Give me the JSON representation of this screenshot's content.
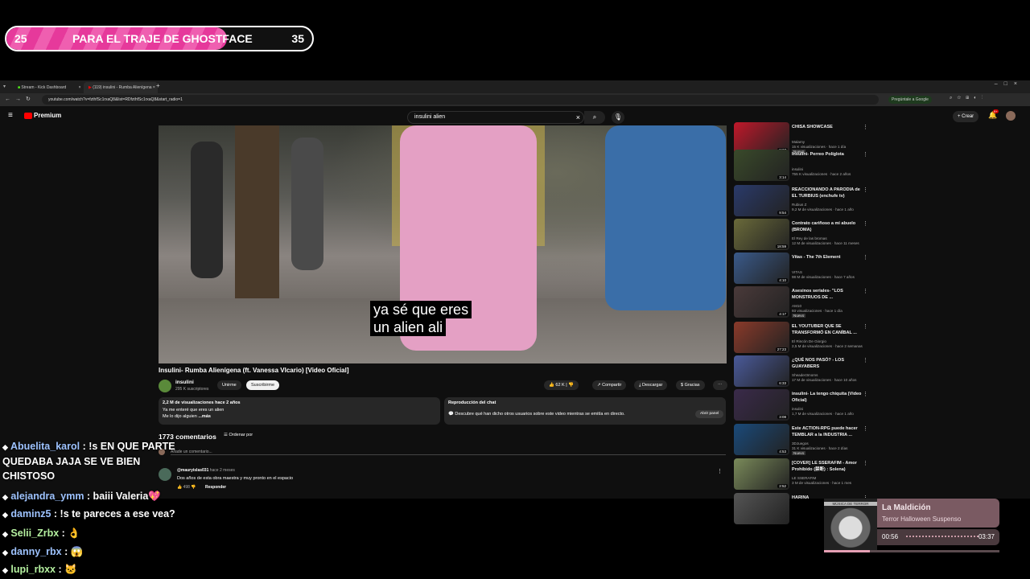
{
  "goal": {
    "start": "25",
    "label": "PARA EL TRAJE DE GHOSTFACE",
    "end": "35",
    "progress": 0.72
  },
  "tabs": [
    {
      "label": "Stream - Kick Dashboard",
      "active": false
    },
    {
      "label": "(119) insulini - Rumba Alienígena",
      "active": true
    }
  ],
  "url": "youtube.com/watch?v=fzthfSc1rxaQ8&list=RDfzthfSc1rxaQ8&start_radio=1",
  "ask_google": "Pregúntale a Google",
  "yt": {
    "brand": "Premium",
    "search_value": "insulini alien",
    "create": "Crear",
    "notif": "9+"
  },
  "video": {
    "subtitle_line1": "ya sé que eres",
    "subtitle_line2": "un alien ali",
    "title": "Insulini- Rumba Alienígena (ft. Vanessa Vlcario) [Video Oficial]",
    "channel": "insulini",
    "subs": "295 K suscriptores",
    "join": "Unirme",
    "subscribe": "Suscribirme",
    "likes": "62 K",
    "share": "Compartir",
    "download": "Descargar",
    "thanks": "Gracias",
    "views": "2,2 M de visualizaciones  hace 2 años",
    "desc1": "Ya me enteré que eres un alien",
    "desc2": "Me lo dijo alguien",
    "more": "...más",
    "chat_replay_title": "Reproducción del chat",
    "chat_replay_text": "Descubre qué han dicho otros usuarios sobre este video mientras se emitía en directo.",
    "open_panel": "Abrir panel",
    "comments_count": "1773 comentarios",
    "sort": "Ordenar por",
    "add_comment": "Añade un comentario...",
    "comment_user": "@mauryislas031",
    "comment_time": "hace 2 meses",
    "comment_text": "Dos años de esta obra maestra y muy pronto en el espacio",
    "comment_likes": "498",
    "reply": "Responder"
  },
  "recs": [
    {
      "title": "CHISA SHOWCASE",
      "channel": "Malamy",
      "meta": "15 K visualizaciones · hace 1 día",
      "dur": "8:27",
      "badge": "Nuevo",
      "color": "#c0182a"
    },
    {
      "title": "Insulini- Perreo Políglota",
      "channel": "insulini",
      "meta": "755 K visualizaciones · hace 2 años",
      "dur": "3:14",
      "badge": "",
      "color": "#3a4a2a"
    },
    {
      "title": "REACCIONANDO A PARODIA de EL TURBIUS (enchufe tv)",
      "channel": "Rubius Z",
      "meta": "9,2 M de visualizaciones · hace 1 año",
      "dur": "9:54",
      "badge": "",
      "color": "#2a3a6a"
    },
    {
      "title": "Contrato cariñoso a mi abuelo (BROMA)",
      "channel": "El Rey de las bromas",
      "meta": "12 M de visualizaciones · hace 11 meses",
      "dur": "18:59",
      "badge": "",
      "color": "#6a6a3a"
    },
    {
      "title": "Vitas - The 7th Element",
      "channel": "VITAS",
      "meta": "98 M de visualizaciones · hace 7 años",
      "dur": "4:10",
      "badge": "",
      "color": "#3a5a8a"
    },
    {
      "title": "Asesinos seriales- \"LOS MONSTRUOS DE ...",
      "channel": "AM10",
      "meta": "93 visualizaciones · hace 1 día",
      "dur": "4:17",
      "badge": "Nuevo",
      "color": "#4a3a3a"
    },
    {
      "title": "EL YOUTUBER QUE SE TRANSFORMÓ EN CANÍBAL ...",
      "channel": "El Rincón De Giorgio",
      "meta": "2,5 M de visualizaciones · hace 2 semanas",
      "dur": "27:23",
      "badge": "",
      "color": "#8a3a2a"
    },
    {
      "title": "¿QUÉ NOS PASÓ? - LOS GUAYABERS",
      "channel": "Sheader3moms",
      "meta": "17 M de visualizaciones · hace 10 años",
      "dur": "6:33",
      "badge": "",
      "color": "#4a5a9a"
    },
    {
      "title": "insulini- La tengo chiquita (Video Oficial)",
      "channel": "insulini",
      "meta": "1,7 M de visualizaciones · hace 1 año",
      "dur": "3:08",
      "badge": "",
      "color": "#3a2a4a"
    },
    {
      "title": "Este ACTION-RPG puede hacer TEMBLAR a la INDUSTRIA ...",
      "channel": "3DJuegos",
      "meta": "31 K visualizaciones · hace 2 días",
      "dur": "4:53",
      "badge": "Nuevo",
      "color": "#1a4a7a"
    },
    {
      "title": "[COVER] LE SSERAFIM - Amor Prohibido (禁断) : Solena)",
      "channel": "LE SSERAFIM",
      "meta": "3 M de visualizaciones · hace 1 mes",
      "dur": "2:52",
      "badge": "",
      "color": "#7a8a5a"
    },
    {
      "title": "HARINA",
      "channel": "",
      "meta": "",
      "dur": "",
      "badge": "",
      "color": "#555555"
    }
  ],
  "chat": [
    {
      "user": "Abuelita_karol",
      "text": ": !s EN QUE PARTE QUEDABA JAJA SE VE BIEN CHISTOSO",
      "color": "#9ec3ff"
    },
    {
      "user": "alejandra_ymm",
      "text": ": baiii Valeria💖",
      "color": "#9ec3ff"
    },
    {
      "user": "daminz5",
      "text": ": !s te pareces a ese vea?",
      "color": "#9ec3ff"
    },
    {
      "user": "Selii_Zrbx",
      "text": ": 👌",
      "color": "#b5f0a0"
    },
    {
      "user": "danny_rbx",
      "text": ": 😱",
      "color": "#9ec3ff"
    },
    {
      "user": "lupi_rbxx",
      "text": ": 🐱",
      "color": "#b5f0a0"
    }
  ],
  "music": {
    "title": "La Maldición",
    "artist": "Terror Halloween Suspenso",
    "current": "00:56",
    "total": "03:37",
    "progress": 0.26,
    "art_text": "MÚSICA DE TERROR"
  }
}
